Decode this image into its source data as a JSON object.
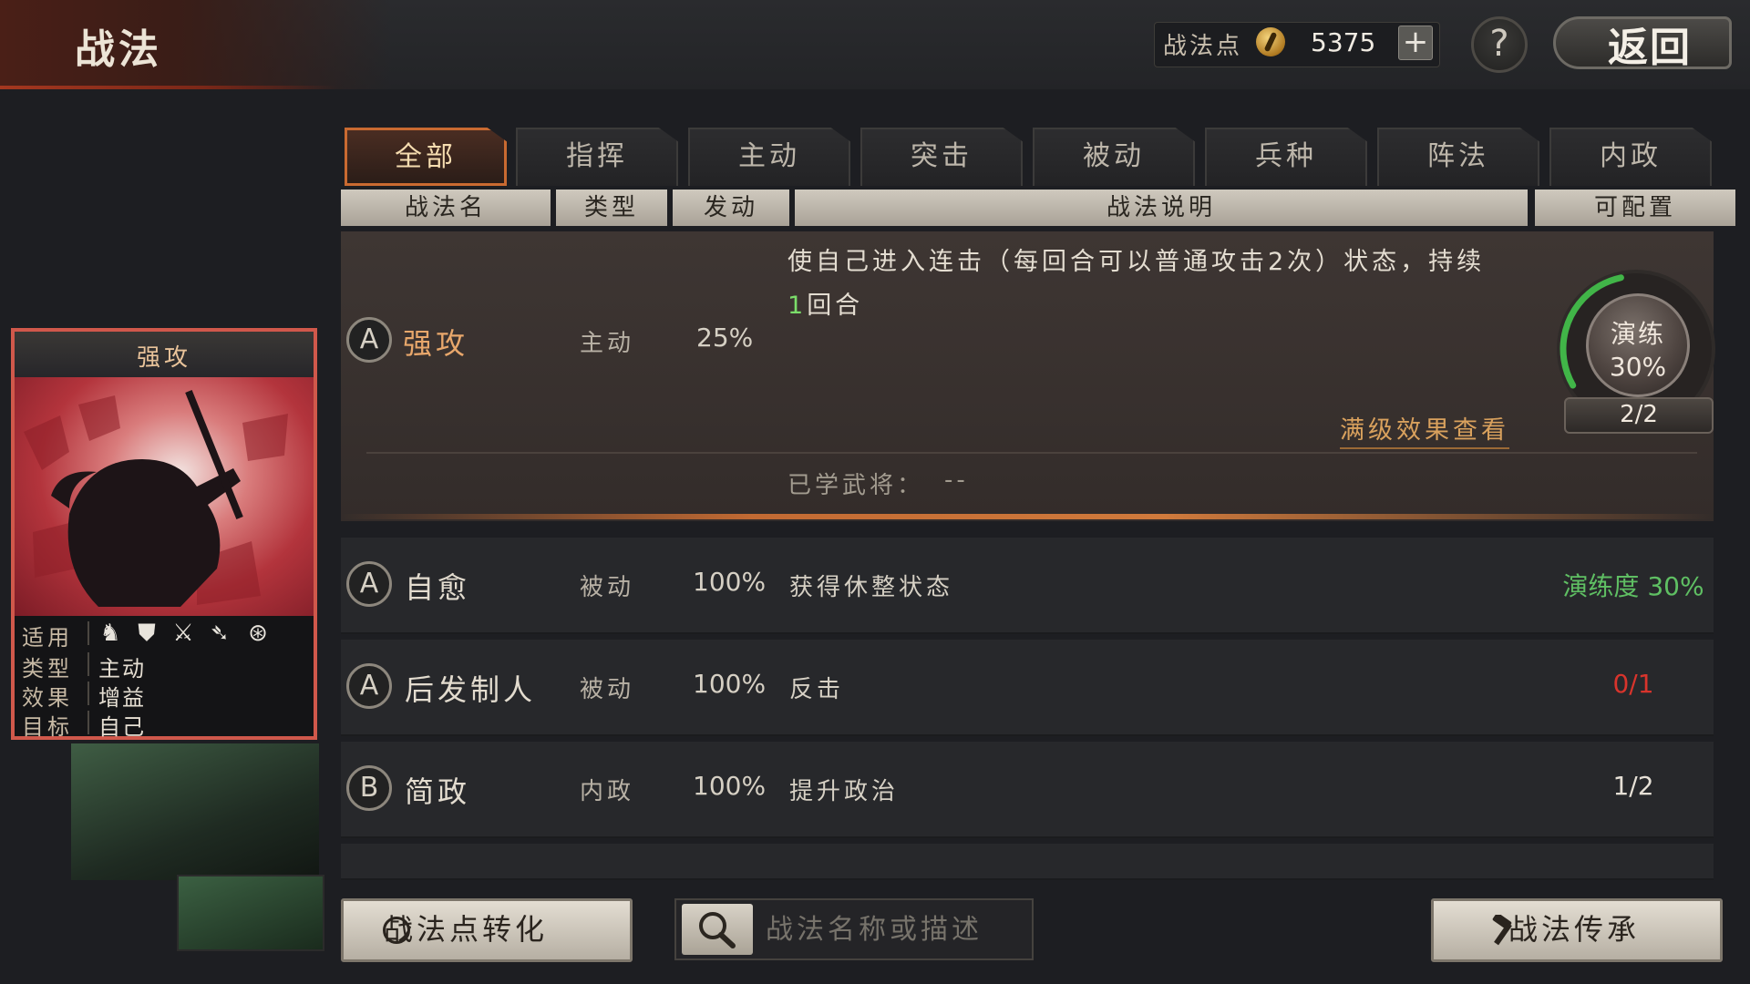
{
  "header": {
    "title": "战法",
    "points_label": "战法点",
    "points_value": "5375",
    "add_symbol": "+",
    "help_symbol": "?",
    "back_label": "返回"
  },
  "tabs": [
    "全部",
    "指挥",
    "主动",
    "突击",
    "被动",
    "兵种",
    "阵法",
    "内政"
  ],
  "columns": {
    "name": "战法名",
    "type": "类型",
    "trigger": "发动",
    "desc": "战法说明",
    "configurable": "可配置"
  },
  "selected": {
    "grade": "A",
    "name": "强攻",
    "type": "主动",
    "rate": "25%",
    "desc_line1": "使自己进入连击（每回合可以普通攻击2次）状态，持续",
    "desc_turns": "1",
    "desc_line2": "回合",
    "full_effect_link": "满级效果查看",
    "learned_label": "已学武将：",
    "learned_value": "--",
    "practice_label": "演练",
    "practice_percent": "30%",
    "practice_progress": 0.3,
    "practice_count": "2/2"
  },
  "rows": [
    {
      "grade": "A",
      "name": "自愈",
      "type": "被动",
      "rate": "100%",
      "desc": "获得休整状态",
      "config": "演练度 30%",
      "config_color": "#5fbf63"
    },
    {
      "grade": "A",
      "name": "后发制人",
      "type": "被动",
      "rate": "100%",
      "desc": "反击",
      "config": "0/1",
      "config_color": "#d8342c"
    },
    {
      "grade": "B",
      "name": "简政",
      "type": "内政",
      "rate": "100%",
      "desc": "提升政治",
      "config": "1/2",
      "config_color": "#e6e0d6"
    }
  ],
  "card": {
    "title": "强攻",
    "applicable_label": "适用",
    "troop_icons": [
      "cavalry-icon",
      "shield-icon",
      "spear-icon",
      "bow-icon",
      "wheel-icon"
    ],
    "type_label": "类型",
    "type_value": "主动",
    "effect_label": "效果",
    "effect_value": "增益",
    "target_label": "目标",
    "target_value": "自己"
  },
  "footer": {
    "convert_label": "战法点转化",
    "search_placeholder": "战法名称或描述",
    "inherit_label": "战法传承"
  }
}
